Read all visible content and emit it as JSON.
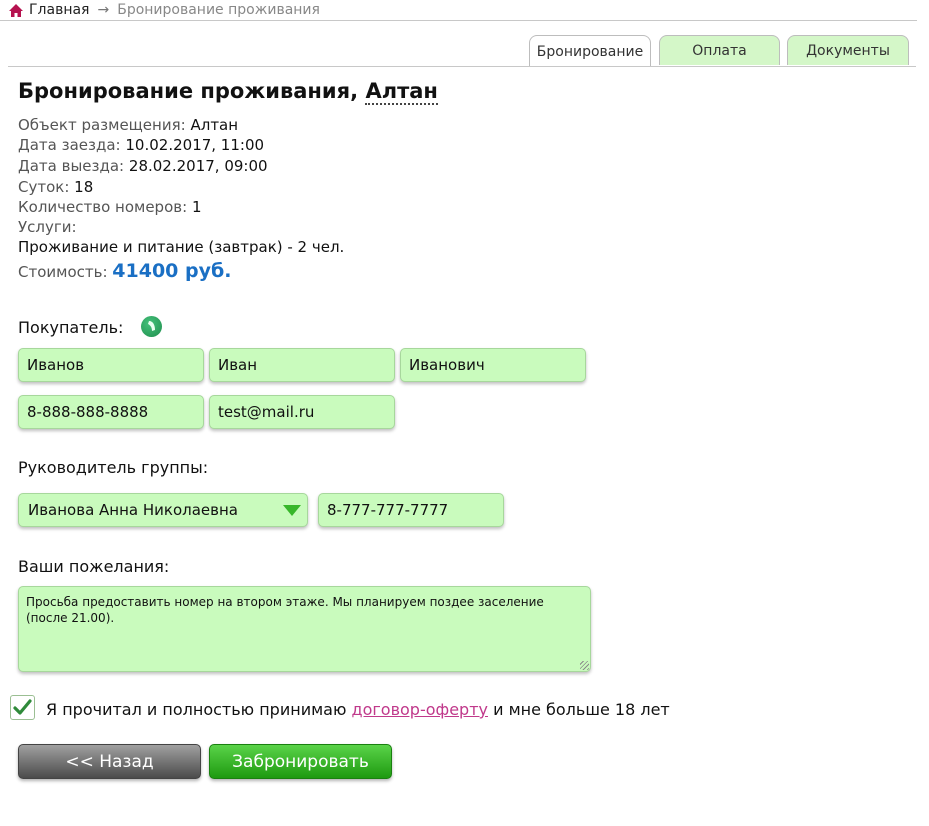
{
  "breadcrumb": {
    "home": "Главная",
    "separator": "→",
    "current": "Бронирование проживания"
  },
  "tabs": [
    {
      "label": "Бронирование",
      "active": true
    },
    {
      "label": "Оплата",
      "active": false
    },
    {
      "label": "Документы",
      "active": false
    }
  ],
  "heading": {
    "prefix": "Бронирование проживания,",
    "object_name": "Алтан"
  },
  "info": {
    "object": {
      "label": "Объект размещения:",
      "value": "Алтан"
    },
    "checkin": {
      "label": "Дата заезда:",
      "value": "10.02.2017, 11:00"
    },
    "checkout": {
      "label": "Дата выезда:",
      "value": "28.02.2017, 09:00"
    },
    "nights": {
      "label": "Суток:",
      "value": "18"
    },
    "rooms": {
      "label": "Количество номеров:",
      "value": "1"
    },
    "services": {
      "label": "Услуги:",
      "value": "Проживание и питание (завтрак) - 2 чел."
    },
    "cost": {
      "label": "Стоимость:",
      "value": "41400 руб."
    }
  },
  "buyer": {
    "label": "Покупатель:",
    "last_name": "Иванов",
    "first_name": "Иван",
    "middle_name": "Иванович",
    "phone": "8-888-888-8888",
    "email": "test@mail.ru"
  },
  "group_leader": {
    "label": "Руководитель группы:",
    "selected": "Иванова Анна Николаевна",
    "phone": "8-777-777-7777"
  },
  "wishes": {
    "label": "Ваши пожелания:",
    "text": "Просьба предоставить номер на втором этаже. Мы планируем поздее заселение (после 21.00)."
  },
  "consent": {
    "checked": true,
    "text_before": "Я прочитал и полностью принимаю",
    "link": "договор-оферту",
    "text_after": "и мне больше 18 лет"
  },
  "buttons": {
    "back": "<< Назад",
    "submit": "Забронировать"
  },
  "colors": {
    "field_bg": "#c9fbbd",
    "price": "#1a6fc4",
    "link": "#c0398b",
    "submit_bg": "#2eaa1e",
    "back_bg": "#6a6a6a"
  }
}
